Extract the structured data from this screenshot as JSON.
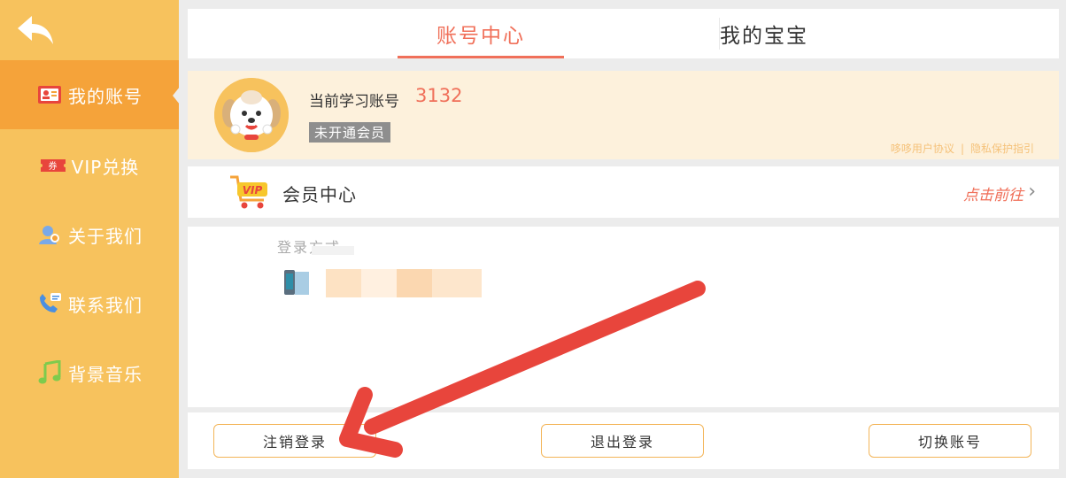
{
  "sidebar": {
    "items": [
      {
        "label": "我的账号",
        "icon": "account-card-icon",
        "active": true
      },
      {
        "label": "VIP兑换",
        "icon": "coupon-icon",
        "active": false
      },
      {
        "label": "关于我们",
        "icon": "person-icon",
        "active": false
      },
      {
        "label": "联系我们",
        "icon": "phone-icon",
        "active": false
      },
      {
        "label": "背景音乐",
        "icon": "music-note-icon",
        "active": false
      }
    ]
  },
  "tabs": [
    {
      "label": "账号中心",
      "active": true
    },
    {
      "label": "我的宝宝",
      "active": false
    }
  ],
  "profile": {
    "account_label": "当前学习账号",
    "account_id": "3132",
    "member_status": "未开通会员",
    "user_agreement_link": "哆哆用户协议",
    "link_separator": "|",
    "privacy_link": "隐私保护指引"
  },
  "vip": {
    "badge": "VIP",
    "label": "会员中心",
    "go_label": "点击前往",
    "chevron": "›"
  },
  "login": {
    "label": "登录方式"
  },
  "actions": {
    "deregister_label": "注销登录",
    "logout_label": "退出登录",
    "switch_label": "切换账号"
  },
  "colors": {
    "sidebar_bg": "#f7c25d",
    "sidebar_active": "#f5a33a",
    "accent": "#f0705a",
    "profile_bg": "#fdf1dc",
    "button_border": "#f3b558",
    "annotation_arrow": "#e8453c"
  }
}
